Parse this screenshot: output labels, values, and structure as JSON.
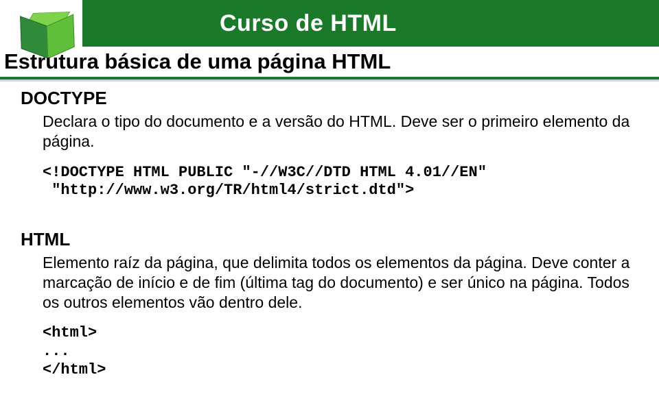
{
  "header": {
    "title": "Curso de HTML",
    "subtitle": "Estrutura básica de uma página HTML"
  },
  "sections": [
    {
      "heading": "DOCTYPE",
      "body": "Declara o tipo do documento e a versão do HTML. Deve ser o primeiro elemento da página.",
      "code": "<!DOCTYPE HTML PUBLIC \"-//W3C//DTD HTML 4.01//EN\"\n \"http://www.w3.org/TR/html4/strict.dtd\">"
    },
    {
      "heading": "HTML",
      "body": "Elemento raíz da página, que delimita todos os elementos da página. Deve conter a marcação de início e de fim (última tag do documento) e ser único na página. Todos os outros elementos vão dentro dele.",
      "code": "<html>\n...\n</html>"
    }
  ]
}
